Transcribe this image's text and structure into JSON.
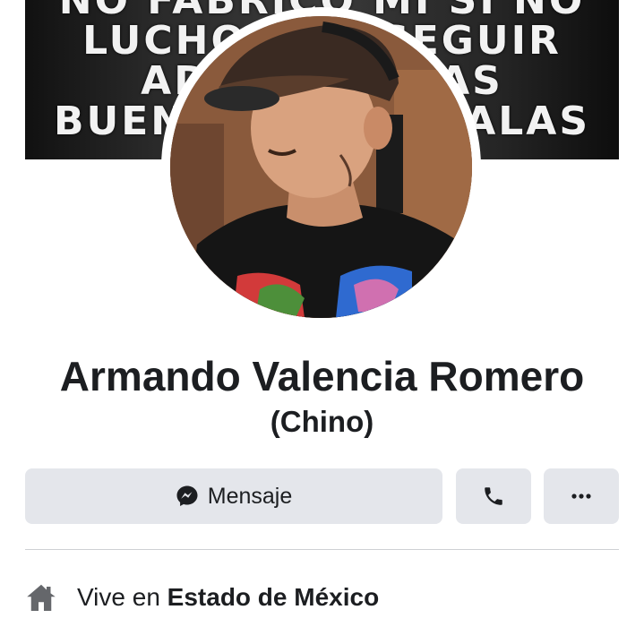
{
  "cover": {
    "lines": [
      "NO FABRICO MI SI NO",
      "LUCHO POR SEGUIR",
      "ADELANTE LAS",
      "BUENAS Y LAS MALAS"
    ]
  },
  "profile": {
    "name": "Armando Valencia Romero",
    "nickname": "(Chino)"
  },
  "actions": {
    "message_label": "Mensaje",
    "message_icon": "messenger-icon",
    "call_icon": "phone-icon",
    "more_icon": "more-dots-icon"
  },
  "intro": {
    "icon": "home-icon",
    "lives_prefix": "Vive en",
    "location": "Estado de México"
  }
}
